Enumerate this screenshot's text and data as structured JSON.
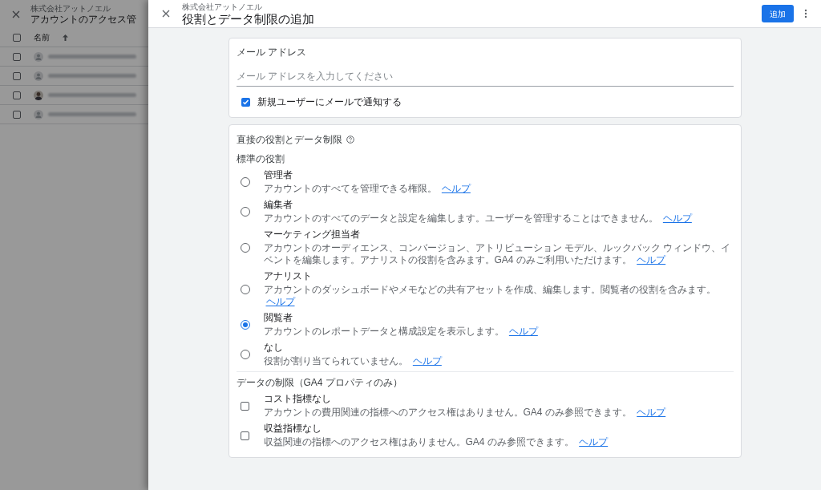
{
  "background_page": {
    "subtitle": "株式会社アットノエル",
    "title": "アカウントのアクセス管",
    "column": "名前",
    "select_all_checked": false,
    "rows": [
      {
        "kind": "generic",
        "checked": false
      },
      {
        "kind": "generic",
        "checked": false
      },
      {
        "kind": "photo",
        "checked": false
      },
      {
        "kind": "generic",
        "checked": false
      }
    ]
  },
  "dialog": {
    "subtitle": "株式会社アットノエル",
    "title": "役割とデータ制限の追加",
    "add_button": "追加"
  },
  "email_card": {
    "title": "メール アドレス",
    "placeholder": "メール アドレスを入力してください",
    "notify": {
      "label": "新規ユーザーにメールで通知する",
      "checked": true
    }
  },
  "roles_card": {
    "title": "直接の役割とデータ制限",
    "standard_roles_label": "標準の役割",
    "roles": [
      {
        "name": "管理者",
        "description": "アカウントのすべてを管理できる権限。",
        "help": "ヘルプ",
        "selected": false
      },
      {
        "name": "編集者",
        "description": "アカウントのすべてのデータと設定を編集します。ユーザーを管理することはできません。",
        "help": "ヘルプ",
        "selected": false
      },
      {
        "name": "マーケティング担当者",
        "description": "アカウントのオーディエンス、コンバージョン、アトリビューション モデル、ルックバック ウィンドウ、イベントを編集します。アナリストの役割を含みます。GA4 のみご利用いただけます。",
        "help": "ヘルプ",
        "selected": false
      },
      {
        "name": "アナリスト",
        "description": "アカウントのダッシュボードやメモなどの共有アセットを作成、編集します。閲覧者の役割を含みます。",
        "help": "ヘルプ",
        "selected": false
      },
      {
        "name": "閲覧者",
        "description": "アカウントのレポートデータと構成設定を表示します。",
        "help": "ヘルプ",
        "selected": true
      },
      {
        "name": "なし",
        "description": "役割が割り当てられていません。",
        "help": "ヘルプ",
        "selected": false
      }
    ],
    "restrictions_label": "データの制限（GA4 プロパティのみ）",
    "restrictions": [
      {
        "name": "コスト指標なし",
        "description": "アカウントの費用関連の指標へのアクセス権はありません。GA4 のみ参照できます。",
        "help": "ヘルプ",
        "checked": false
      },
      {
        "name": "収益指標なし",
        "description": "収益関連の指標へのアクセス権はありません。GA4 のみ参照できます。",
        "help": "ヘルプ",
        "checked": false
      }
    ]
  }
}
